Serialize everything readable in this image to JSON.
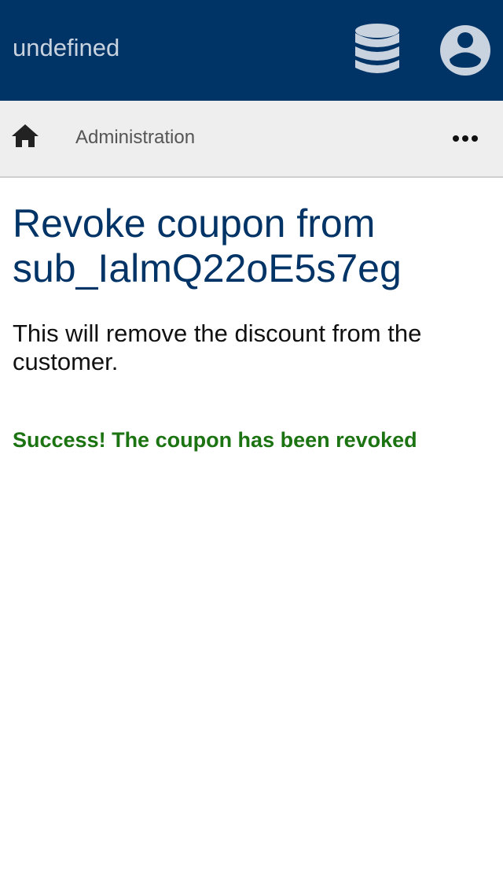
{
  "header": {
    "app_title": "undefined",
    "database_icon": "database-icon",
    "account_icon": "account-circle-icon",
    "color": "#003366",
    "icon_color": "#c9d3df"
  },
  "nav": {
    "home_icon": "home-icon",
    "breadcrumb": "Administration",
    "more_icon": "more-horizontal-icon",
    "background": "#eeeeee"
  },
  "main": {
    "title": "Revoke coupon from sub_IalmQ22oE5s7eg",
    "description": "This will remove the discount from the customer.",
    "success_message": "Success! The coupon has been revoked",
    "title_color": "#003366",
    "success_color": "#1b7312"
  }
}
